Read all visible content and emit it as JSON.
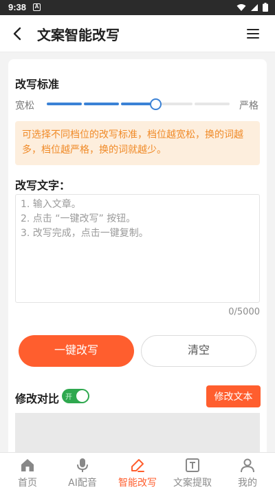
{
  "status_bar": {
    "time": "9:38",
    "notification_glyph": "A",
    "icons": [
      "wifi-icon",
      "signal-icon",
      "battery-icon"
    ]
  },
  "app_bar": {
    "title": "文案智能改写",
    "back_icon": "back-arrow-icon",
    "menu_icon": "hamburger-menu-icon"
  },
  "rewrite_standard": {
    "title": "改写标准",
    "min_label": "宽松",
    "max_label": "严格",
    "level": 3,
    "levels_total": 5,
    "active_color": "#3b82d6",
    "inactive_color": "#e6e6e6",
    "tip": "可选择不同档位的改写标准，档位越宽松，换的词越多，档位越严格，换的词就越少。"
  },
  "rewrite_text": {
    "title": "改写文字：",
    "placeholder": "1. 输入文章。\n2. 点击 “一键改写” 按钮。\n3. 改写完成，点击一键复制。",
    "value": "",
    "counter": "0/5000"
  },
  "actions": {
    "rewrite_label": "一键改写",
    "clear_label": "清空"
  },
  "compare": {
    "title": "修改对比",
    "toggle_label": "开",
    "toggle_on": true,
    "edit_label": "修改文本"
  },
  "tabs": [
    {
      "label": "首页",
      "icon": "home-icon",
      "active": false
    },
    {
      "label": "AI配音",
      "icon": "microphone-icon",
      "active": false
    },
    {
      "label": "智能改写",
      "icon": "edit-pen-icon",
      "active": true
    },
    {
      "label": "文案提取",
      "icon": "text-extract-icon",
      "active": false
    },
    {
      "label": "我的",
      "icon": "user-icon",
      "active": false
    }
  ],
  "colors": {
    "accent": "#ff5e2e",
    "toggle_on": "#2fa84f",
    "tip_bg": "#fdeedd",
    "tip_text": "#f08a27"
  }
}
